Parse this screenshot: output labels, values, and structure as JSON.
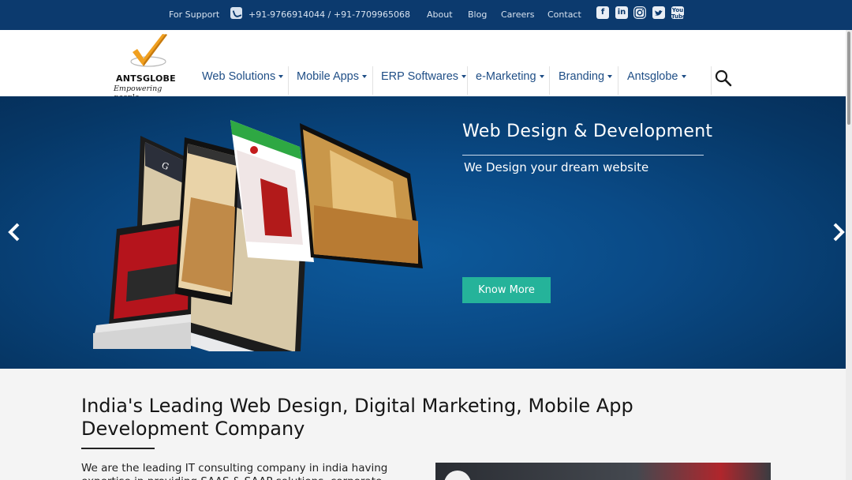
{
  "topbar": {
    "support_label": "For Support",
    "phones": "+91-9766914044 / +91-7709965068",
    "links": [
      "About",
      "Blog",
      "Careers",
      "Contact"
    ],
    "social_icons": [
      "facebook-icon",
      "linkedin-icon",
      "instagram-icon",
      "twitter-icon",
      "youtube-icon"
    ]
  },
  "header": {
    "logo_brand": "ANTSGLOBE",
    "logo_tagline": "Empowering people",
    "nav": [
      "Web Solutions",
      "Mobile Apps",
      "ERP Softwares",
      "e-Marketing",
      "Branding",
      "Antsglobe"
    ]
  },
  "hero": {
    "title": "Web Design & Development",
    "subtitle": "We Design your dream website",
    "cta_label": "Know More"
  },
  "content": {
    "heading": "India's Leading Web Design, Digital Marketing, Mobile App Development Company",
    "intro": "We are the leading IT consulting company in india having expertise in providing SAAS & SAAP solutions, corporate branding, UI/UX"
  },
  "colors": {
    "topbar_bg": "#0c3a6e",
    "nav_text": "#1f4e86",
    "hero_bg": "#0a4a86",
    "cta_bg": "#25b39a",
    "logo_check": "#f0a020"
  }
}
